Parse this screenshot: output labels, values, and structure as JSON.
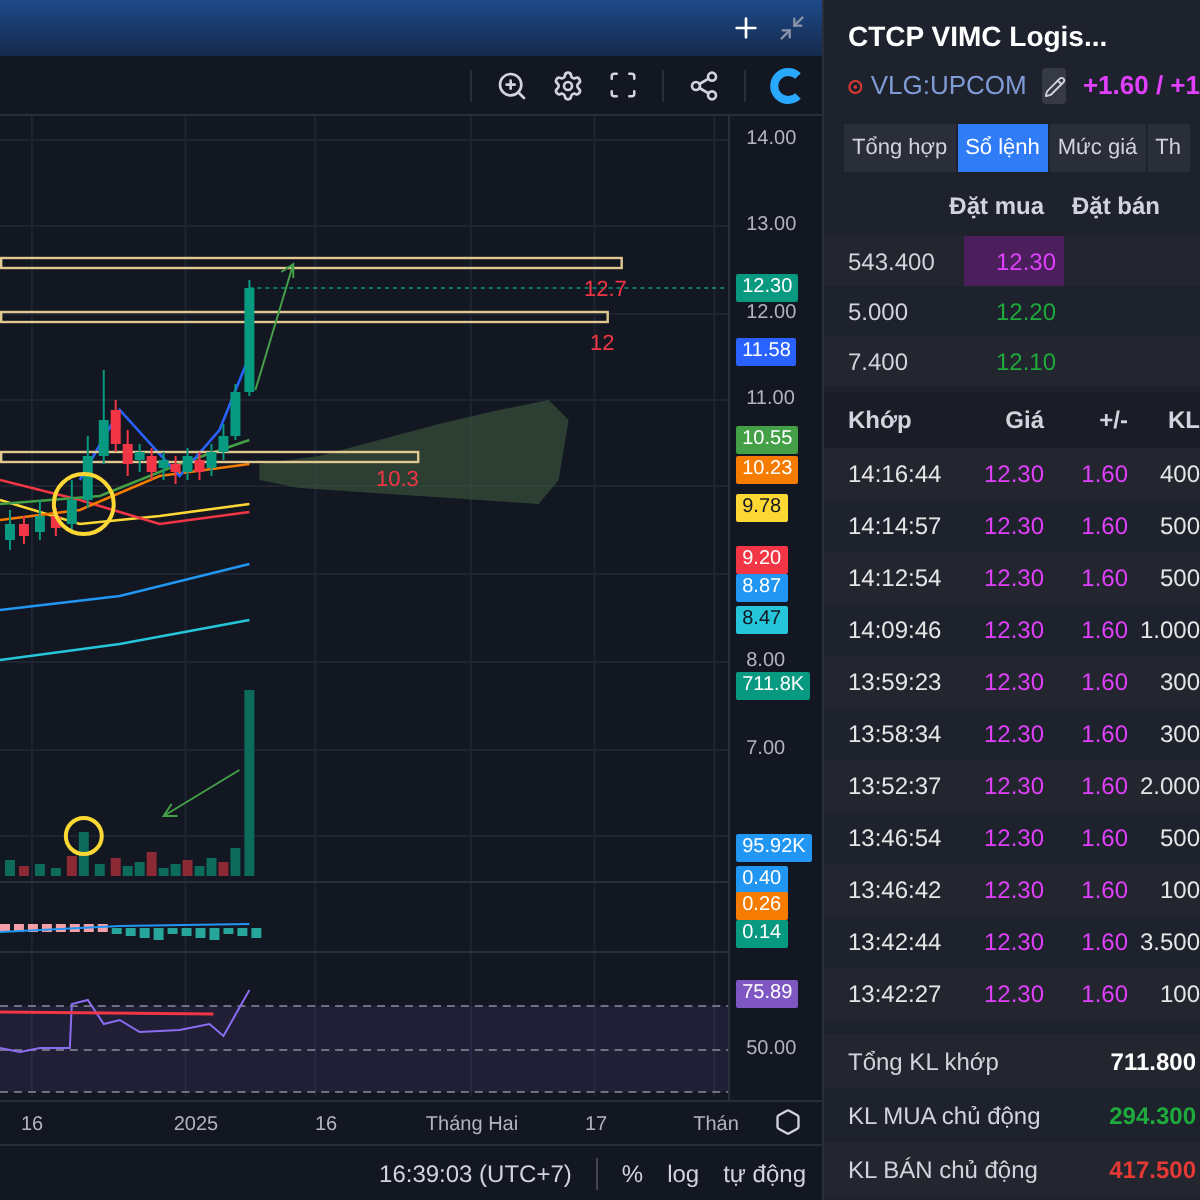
{
  "chart": {
    "levels": [
      {
        "label": "12.7"
      },
      {
        "label": "12"
      },
      {
        "label": "10.3"
      }
    ],
    "price_axis": [
      {
        "kind": "tick",
        "label": "14.00"
      },
      {
        "kind": "tick",
        "label": "13.00"
      },
      {
        "kind": "tag",
        "label": "12.30",
        "color": "#089981"
      },
      {
        "kind": "tick",
        "label": "12.00"
      },
      {
        "kind": "tag",
        "label": "11.58",
        "color": "#2962ff"
      },
      {
        "kind": "tick",
        "label": "11.00"
      },
      {
        "kind": "tag",
        "label": "10.55",
        "color": "#43a047"
      },
      {
        "kind": "tag",
        "label": "10.23",
        "color": "#f57c00"
      },
      {
        "kind": "tag",
        "label": "9.78",
        "color": "#fdd835"
      },
      {
        "kind": "tag",
        "label": "9.20",
        "color": "#f23645"
      },
      {
        "kind": "tag",
        "label": "8.87",
        "color": "#2196f3"
      },
      {
        "kind": "tag",
        "label": "8.47",
        "color": "#26c6da"
      },
      {
        "kind": "tick",
        "label": "8.00"
      },
      {
        "kind": "tag",
        "label": "711.8K",
        "color": "#089981"
      },
      {
        "kind": "tick",
        "label": "7.00"
      },
      {
        "kind": "tag",
        "label": "95.92K",
        "color": "#2196f3"
      },
      {
        "kind": "tag",
        "label": "0.40",
        "color": "#2196f3"
      },
      {
        "kind": "tag",
        "label": "0.26",
        "color": "#f57c00"
      },
      {
        "kind": "tag",
        "label": "0.14",
        "color": "#089981"
      },
      {
        "kind": "tag",
        "label": "75.89",
        "color": "#7e57c2"
      },
      {
        "kind": "tick",
        "label": "50.00"
      }
    ],
    "time_axis": [
      "16",
      "2025",
      "16",
      "Tháng Hai",
      "17",
      "Thán"
    ]
  },
  "status_bar": {
    "time": "16:39:03 (UTC+7)",
    "options": [
      "%",
      "log",
      "tự động"
    ]
  },
  "panel": {
    "title": "CTCP VIMC Logis...",
    "symbol": "VLG:UPCOM",
    "change": "+1.60 / +1",
    "tabs": [
      {
        "label": "Tổng hợp",
        "selected": false
      },
      {
        "label": "Sổ lệnh",
        "selected": true
      },
      {
        "label": "Mức giá",
        "selected": false
      },
      {
        "label": "Th",
        "selected": false
      }
    ],
    "book": {
      "columns": [
        "Đặt mua",
        "Đặt bán"
      ],
      "rows": [
        {
          "volume": "543.400",
          "bid": "12.30",
          "color": "#e040fb",
          "highlighted": true
        },
        {
          "volume": "5.000",
          "bid": "12.20",
          "color": "#1faa3c",
          "highlighted": false
        },
        {
          "volume": "7.400",
          "bid": "12.10",
          "color": "#1faa3c",
          "highlighted": false
        }
      ]
    },
    "trades": {
      "columns": [
        "Khớp",
        "Giá",
        "+/-",
        "KL"
      ],
      "rows": [
        [
          "14:16:44",
          "12.30",
          "1.60",
          "400"
        ],
        [
          "14:14:57",
          "12.30",
          "1.60",
          "500"
        ],
        [
          "14:12:54",
          "12.30",
          "1.60",
          "500"
        ],
        [
          "14:09:46",
          "12.30",
          "1.60",
          "1.000"
        ],
        [
          "13:59:23",
          "12.30",
          "1.60",
          "300"
        ],
        [
          "13:58:34",
          "12.30",
          "1.60",
          "300"
        ],
        [
          "13:52:37",
          "12.30",
          "1.60",
          "2.000"
        ],
        [
          "13:46:54",
          "12.30",
          "1.60",
          "500"
        ],
        [
          "13:46:42",
          "12.30",
          "1.60",
          "100"
        ],
        [
          "13:42:44",
          "12.30",
          "1.60",
          "3.500"
        ],
        [
          "13:42:27",
          "12.30",
          "1.60",
          "100"
        ]
      ]
    },
    "summary": [
      {
        "label": "Tổng KL khớp",
        "value": "711.800",
        "color": "#ffffff"
      },
      {
        "label": "KL MUA chủ động",
        "value": "294.300",
        "color": "#1faa3c"
      },
      {
        "label": "KL BÁN chủ động",
        "value": "417.500",
        "color": "#e53935"
      }
    ]
  }
}
